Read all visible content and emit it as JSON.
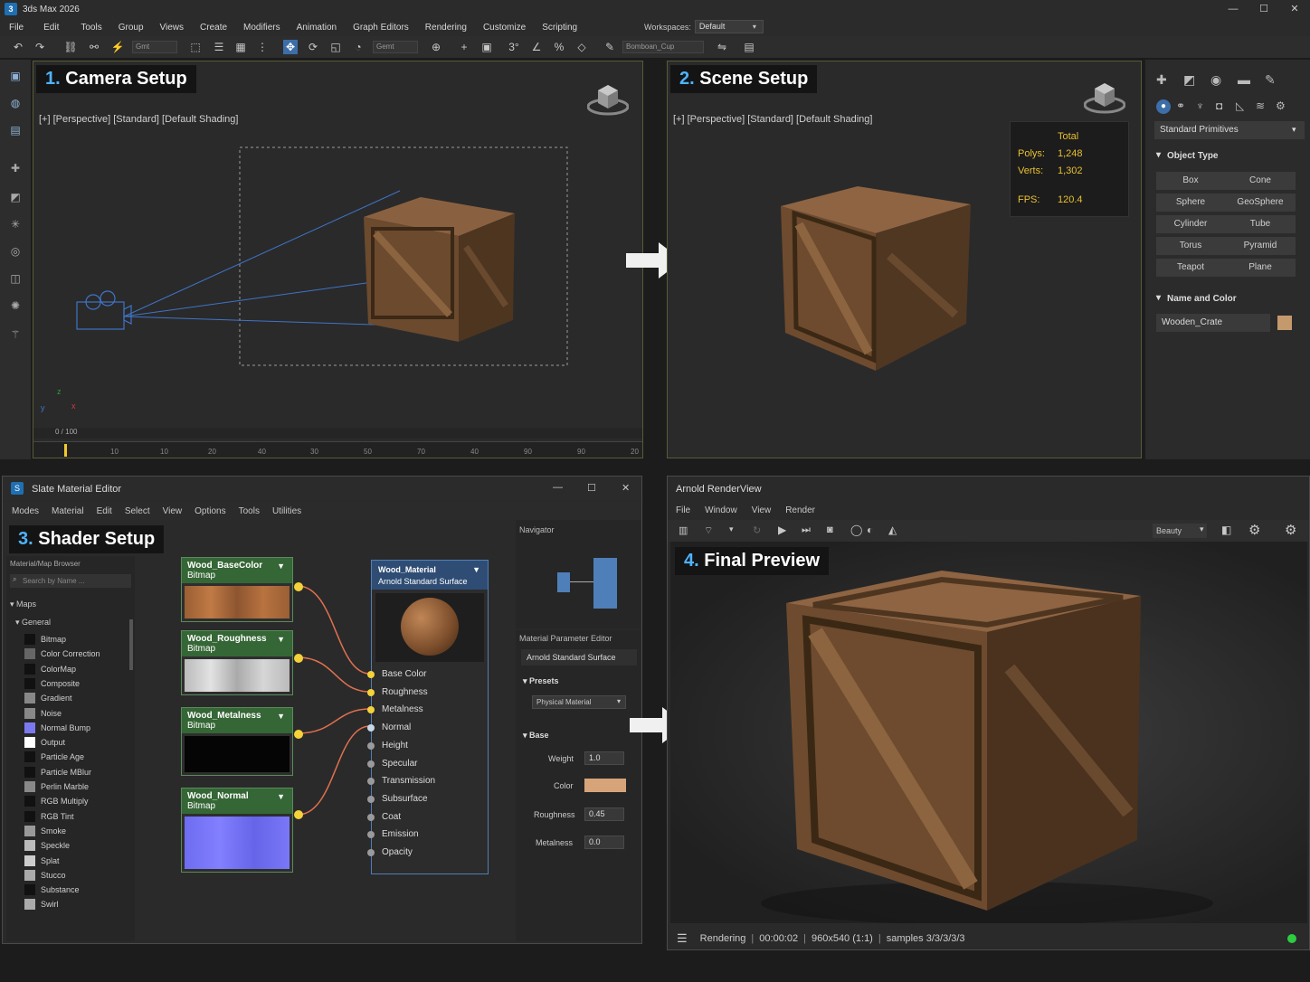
{
  "app": {
    "title": "3ds Max 2026",
    "icon_letter": "3"
  },
  "window_controls": {
    "minimize": "—",
    "maximize": "☐",
    "close": "✕"
  },
  "menu": [
    "File",
    "Edit",
    "Tools",
    "Group",
    "Views",
    "Create",
    "Modifiers",
    "Animation",
    "Graph Editors",
    "Rendering",
    "Customize",
    "Scripting"
  ],
  "workspace": {
    "label": "Workspaces:",
    "value": "Default"
  },
  "toolbar": {
    "selection_filter": "Gmt",
    "coord_system": "Gemt",
    "named_selection": "Bomboan_Cup"
  },
  "viewport1": {
    "number": "1.",
    "heading": "Camera Setup",
    "label": "[+] [Perspective] [Standard] [Default Shading]",
    "axis_z": "z",
    "axis_x": "x",
    "axis_y": "y",
    "frame": "0 / 100",
    "ticks": [
      "10",
      "10",
      "20",
      "40",
      "30",
      "50",
      "70",
      "40",
      "90",
      "90",
      "20"
    ]
  },
  "viewport2": {
    "number": "2.",
    "heading": "Scene Setup",
    "label": "[+] [Perspective] [Standard] [Default Shading]",
    "stats": {
      "total_label": "Total",
      "polys_label": "Polys:",
      "polys": "1,248",
      "verts_label": "Verts:",
      "verts": "1,302",
      "fps_label": "FPS:",
      "fps": "120.4"
    }
  },
  "command_panel": {
    "category": "Standard Primitives",
    "object_type_label": "Object Type",
    "buttons": [
      "Box",
      "Cone",
      "Sphere",
      "GeoSphere",
      "Cylinder",
      "Tube",
      "Torus",
      "Pyramid",
      "Teapot",
      "Plane"
    ],
    "name_color_label": "Name and Color",
    "object_name": "Wooden_Crate",
    "object_color": "#c49a6c"
  },
  "sme": {
    "title": "Slate Material Editor",
    "icon_letter": "S",
    "menu": [
      "Modes",
      "Material",
      "Edit",
      "Select",
      "View",
      "Options",
      "Tools",
      "Utilities"
    ],
    "number": "3.",
    "heading": "Shader Setup",
    "browser": {
      "title": "Material/Map Browser",
      "search_placeholder": "Search by Name ...",
      "maps_label": "Maps",
      "general_label": "General",
      "items": [
        "Bitmap",
        "Color Correction",
        "ColorMap",
        "Composite",
        "Gradient",
        "Noise",
        "Normal Bump",
        "Output",
        "Particle Age",
        "Particle MBlur",
        "Perlin Marble",
        "RGB Multiply",
        "RGB Tint",
        "Smoke",
        "Speckle",
        "Splat",
        "Stucco",
        "Substance",
        "Swirl"
      ]
    },
    "nodes": [
      {
        "name": "Wood_BaseColor",
        "type": "Bitmap"
      },
      {
        "name": "Wood_Roughness",
        "type": "Bitmap"
      },
      {
        "name": "Wood_Metalness",
        "type": "Bitmap"
      },
      {
        "name": "Wood_Normal",
        "type": "Bitmap"
      }
    ],
    "material": {
      "name": "Wood_Material",
      "type": "Arnold Standard Surface",
      "slots": [
        "Base Color",
        "Roughness",
        "Metalness",
        "Normal",
        "Height",
        "Specular",
        "Transmission",
        "Subsurface",
        "Coat",
        "Emission",
        "Opacity"
      ]
    },
    "navigator_label": "Navigator",
    "param_editor": {
      "title": "Material Parameter Editor",
      "material_type": "Arnold Standard Surface",
      "presets_label": "Presets",
      "preset_value": "Physical Material",
      "base_label": "Base",
      "weight_label": "Weight",
      "weight": "1.0",
      "color_label": "Color",
      "color": "#d7a47a",
      "roughness_label": "Roughness",
      "roughness": "0.45",
      "metalness_label": "Metalness",
      "metalness": "0.0"
    }
  },
  "arv": {
    "title": "Arnold RenderView",
    "menu": [
      "File",
      "Window",
      "View",
      "Render"
    ],
    "aov": "Beauty",
    "number": "4.",
    "heading": "Final Preview",
    "status": {
      "state": "Rendering",
      "time": "00:00:02",
      "resolution": "960x540 (1:1)",
      "samples": "samples 3/3/3/3/3"
    }
  }
}
